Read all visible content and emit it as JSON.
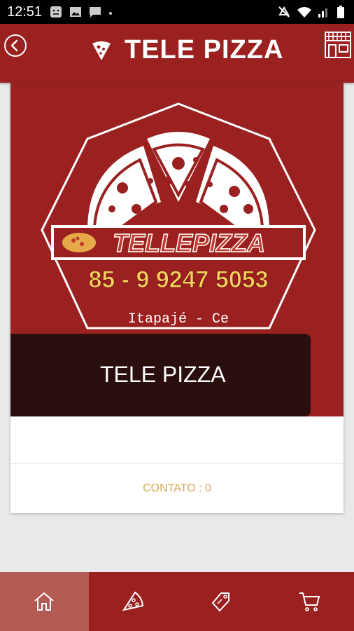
{
  "status_bar": {
    "time": "12:51"
  },
  "app_bar": {
    "title": "TELE PIZZA"
  },
  "store": {
    "logo_brand": "TELLEPIZZA",
    "logo_phone": "85 - 9 9247 5053",
    "logo_city": "Itapajé - Ce",
    "name": "TELE PIZZA",
    "contact": "CONTATO : 0"
  },
  "bottom_nav": {
    "items": [
      {
        "icon": "home-icon",
        "active": true
      },
      {
        "icon": "pizza-slice-icon",
        "active": false
      },
      {
        "icon": "coupon-tag-icon",
        "active": false
      },
      {
        "icon": "shopping-cart-icon",
        "active": false
      }
    ]
  },
  "colors": {
    "primary": "#9b2121",
    "dark_bar": "#2b0f0e",
    "contact_text": "#d2aa56",
    "logo_yellow": "#f2d25c"
  }
}
